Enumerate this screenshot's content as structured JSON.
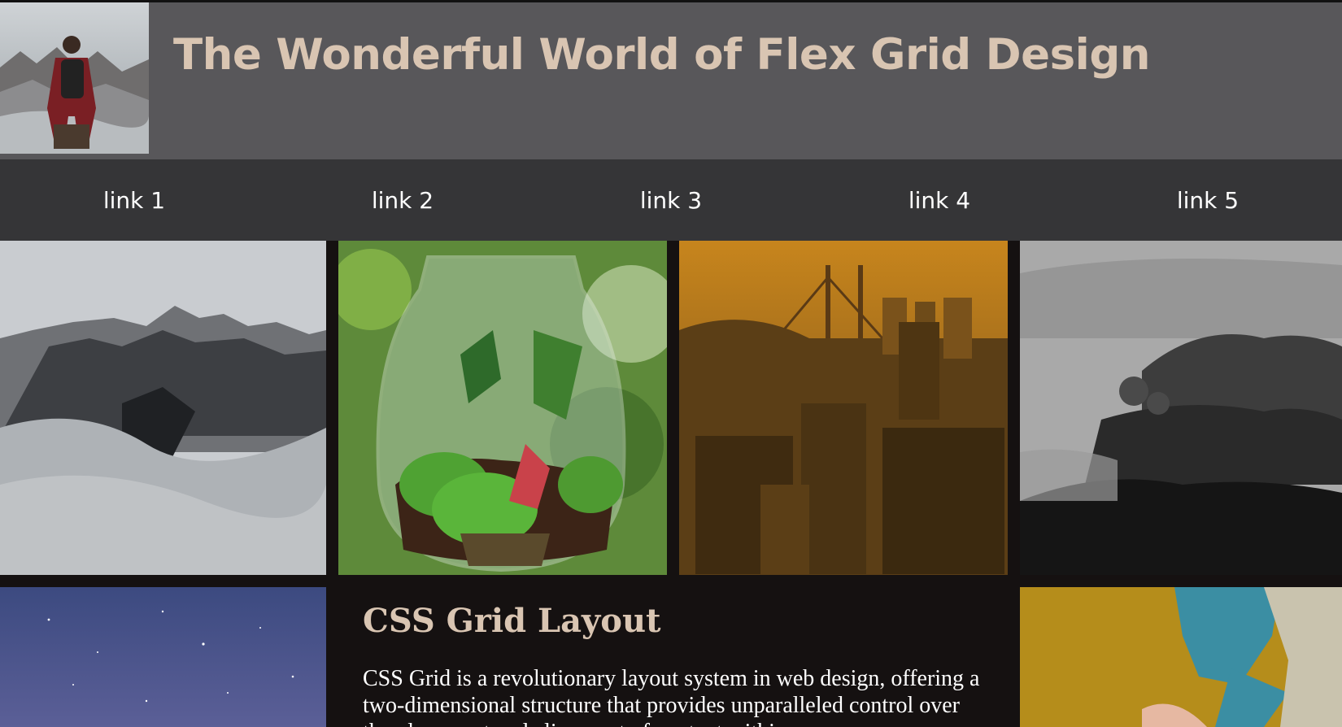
{
  "header": {
    "title": "The Wonderful World of Flex Grid Design",
    "logo_icon": "hiker-photo"
  },
  "nav": {
    "links": [
      "link 1",
      "link 2",
      "link 3",
      "link 4",
      "link 5"
    ]
  },
  "gallery": {
    "images": [
      "snowy-mountain-photo",
      "terrarium-jar-photo",
      "golden-city-bridge-photo",
      "misty-forest-photo",
      "starry-night-sky-photo",
      "person-in-teal-sweater-photo"
    ]
  },
  "article": {
    "title": "CSS Grid Layout",
    "body": "CSS Grid is a revolutionary layout system in web design, offering a two-dimensional structure that provides unparalleled control over the placement and alignment of content within"
  },
  "colors": {
    "header_bg": "#58575a",
    "nav_bg": "#353537",
    "page_bg": "#151111",
    "title_accent": "#d9c5b2"
  }
}
